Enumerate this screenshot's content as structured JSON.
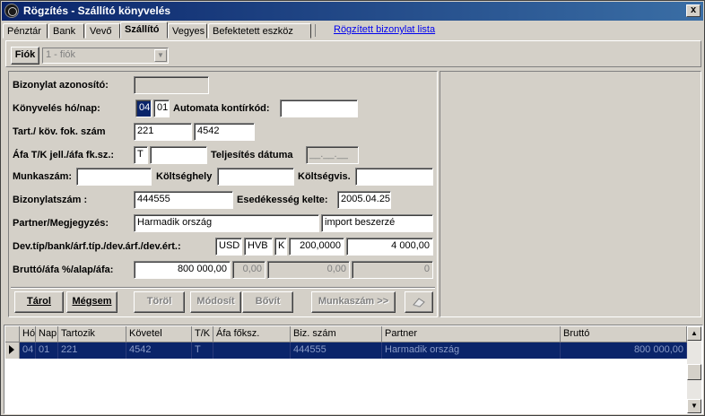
{
  "window": {
    "title": "Rögzítés - Szállító könyvelés",
    "close": "x"
  },
  "tabs": [
    "Pénztár",
    "Bank",
    "Vevő",
    "Szállító",
    "Vegyes",
    "Befektetett eszköz"
  ],
  "tab_link": "Rögzített bizonylat lista",
  "fiok": {
    "button": "Fiók",
    "value": "1 - fiók"
  },
  "form": {
    "bizonylat_azon_label": "Bizonylat azonosító:",
    "bizonylat_azon_value": "",
    "konyv_label": "Könyvelés hó/nap:",
    "konyv_ho": "04",
    "konyv_nap": "01",
    "auto_label": "Automata kontírkód:",
    "auto_value": "",
    "tart_label": "Tart./ köv. fok. szám",
    "tart_value": "221",
    "kov_value": "4542",
    "afa_label": "Áfa T/K jell./áfa fk.sz.:",
    "afa_tk": "T",
    "afa_fksz": "",
    "telj_label": "Teljesítés dátuma",
    "telj_value": "__.__.__",
    "munka_label": "Munkaszám:",
    "munka_value": "",
    "kolts_label": "Költséghely",
    "kolts_value": "",
    "koltsvis_label": "Költségvis.",
    "koltsvis_value": "",
    "bizszam_label": "Bizonylatszám :",
    "bizszam_value": "444555",
    "esed_label": "Esedékesség kelte:",
    "esed_value": "2005.04.25",
    "partner_label": "Partner/Megjegyzés:",
    "partner_value": "Harmadik ország",
    "megj_value": "import beszerzé",
    "dev_label": "Dev.típ/bank/árf.típ./dev.árf./dev.ért.:",
    "dev_tip": "USD",
    "dev_bank": "HVB",
    "dev_arftip": "K",
    "dev_arf": "200,0000",
    "dev_ert": "4 000,00",
    "brutto_label": "Bruttó/áfa %/alap/áfa:",
    "brutto_value": "800 000,00",
    "afa_pct": "0,00",
    "alap": "0,00",
    "afa_val": "0"
  },
  "buttons": {
    "tarol": "Tárol",
    "megsem": "Mégsem",
    "torol": "Töröl",
    "modosit": "Módosít",
    "bovit": "Bővít",
    "munkaszam": "Munkaszám >>"
  },
  "grid": {
    "headers": [
      "Hó",
      "Nap",
      "Tartozik",
      "Követel",
      "T/K",
      "Áfa főksz.",
      "Biz. szám",
      "Partner",
      "Bruttó"
    ],
    "row": [
      "04",
      "01",
      "221",
      "4542",
      "T",
      "",
      "444555",
      "Harmadik ország",
      "800 000,00"
    ]
  }
}
